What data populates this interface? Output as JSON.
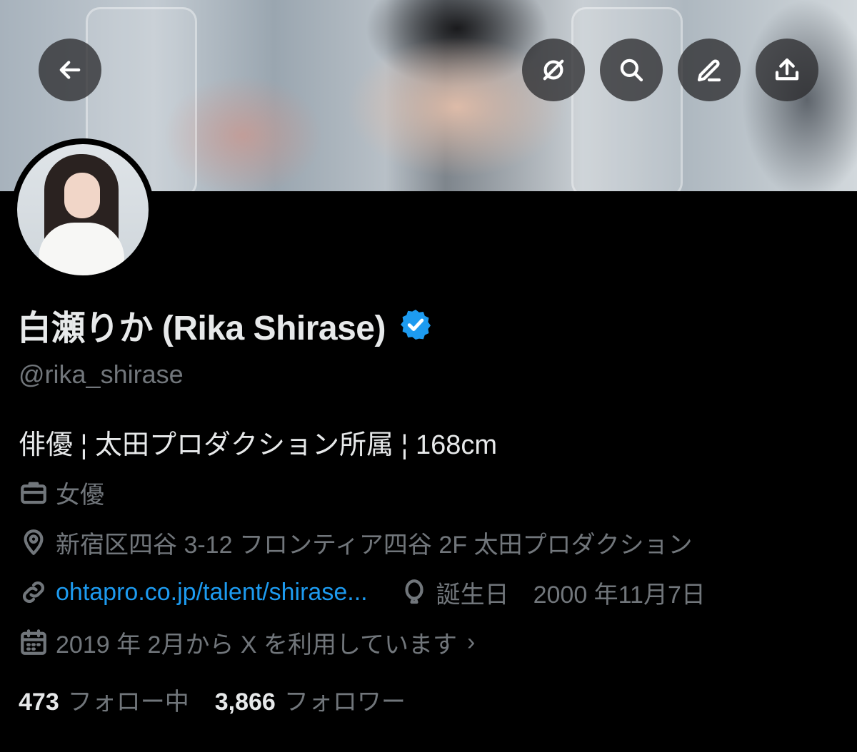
{
  "header": {
    "back_icon": "arrow-left-icon",
    "actions": [
      {
        "icon": "grok-icon"
      },
      {
        "icon": "search-icon"
      },
      {
        "icon": "edit-icon"
      },
      {
        "icon": "share-icon"
      }
    ]
  },
  "profile": {
    "display_name": "白瀬りか (Rika Shirase)",
    "verified_color": "#1d9bf0",
    "handle": "@rika_shirase",
    "bio": "俳優 ¦ 太田プロダクション所属 ¦ 168cm",
    "category": "女優",
    "location": "新宿区四谷 3-12 フロンティア四谷 2F 太田プロダクション",
    "url": "ohtapro.co.jp/talent/shirase...",
    "birthday": "誕生日　2000 年11月7日",
    "joined": "2019 年 2月から X を利用しています",
    "joined_chevron": "›"
  },
  "stats": {
    "following_count": "473",
    "following_label": "フォロー中",
    "followers_count": "3,866",
    "followers_label": "フォロワー"
  },
  "colors": {
    "background": "#000000",
    "text_primary": "#e7e9ea",
    "text_secondary": "#71767b",
    "link": "#1d9bf0"
  }
}
